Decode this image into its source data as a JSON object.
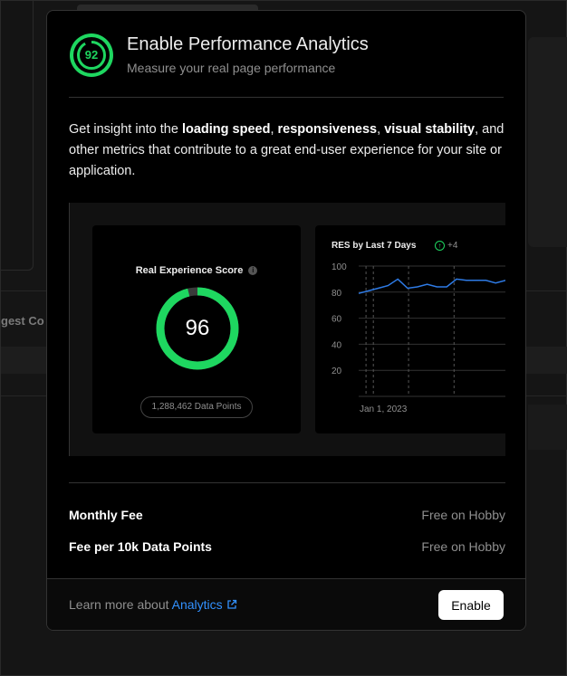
{
  "background": {
    "partial_text": "gest Co"
  },
  "header": {
    "badge_value": "92",
    "title": "Enable Performance Analytics",
    "subtitle": "Measure your real page performance"
  },
  "description": {
    "intro": "Get insight into the ",
    "bold1": "loading speed",
    "sep1": ", ",
    "bold2": "responsiveness",
    "sep2": ", ",
    "bold3": "visual stability",
    "rest": ", and other metrics that contribute to a great end-user experience for your site or application."
  },
  "score_card": {
    "title": "Real Experience Score",
    "info_icon": "i",
    "score": "96",
    "score_value": 96,
    "data_points": "1,288,462 Data Points"
  },
  "chart_card": {
    "title": "RES by Last 7 Days",
    "delta_icon": "↑",
    "delta": "+4",
    "date_label": "Jan 1, 2023"
  },
  "chart_data": {
    "type": "line",
    "title": "RES by Last 7 Days",
    "xlabel": "",
    "ylabel": "",
    "ylim": [
      0,
      100
    ],
    "yticks": [
      20,
      40,
      60,
      80,
      100
    ],
    "x_tick_labels": [
      "Jan 1, 2023"
    ],
    "grid": true,
    "series": [
      {
        "values": [
          79,
          81,
          83,
          85,
          90,
          83,
          84,
          86,
          84,
          84,
          90,
          89,
          89,
          89,
          87,
          89
        ]
      }
    ],
    "colors": {
      "line": "#2e7be6"
    }
  },
  "fees": [
    {
      "label": "Monthly Fee",
      "value": "Free on Hobby"
    },
    {
      "label": "Fee per 10k Data Points",
      "value": "Free on Hobby"
    }
  ],
  "footer": {
    "learn_prefix": "Learn more about ",
    "learn_link": "Analytics",
    "enable_label": "Enable"
  },
  "colors": {
    "accent_green": "#1ed760",
    "link_blue": "#3291ff",
    "line_blue": "#2e7be6"
  },
  "icons": {
    "badge": "score-ring-icon",
    "info": "info-icon",
    "delta": "arrow-up-circle-icon",
    "external": "external-link-icon"
  }
}
